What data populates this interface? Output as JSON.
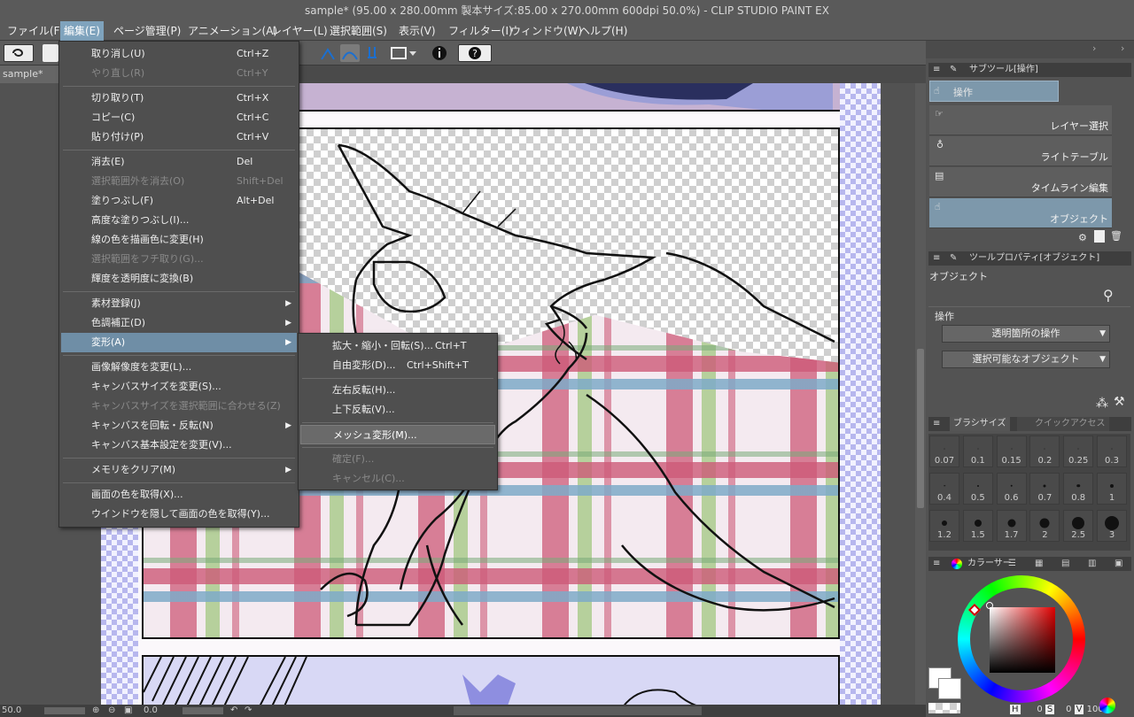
{
  "title": "sample* (95.00 x 280.00mm 製本サイズ:85.00 x 270.00mm 600dpi 50.0%)  - CLIP STUDIO PAINT EX",
  "menubar": [
    "ファイル(F)",
    "編集(E)",
    "ページ管理(P)",
    "アニメーション(A)",
    "レイヤー(L)",
    "選択範囲(S)",
    "表示(V)",
    "フィルター(I)",
    "ウィンドウ(W)",
    "ヘルプ(H)"
  ],
  "doc_tab": "sample*",
  "edit_menu": [
    {
      "label": "取り消し(U)",
      "shortcut": "Ctrl+Z",
      "disabled": false
    },
    {
      "label": "やり直し(R)",
      "shortcut": "Ctrl+Y",
      "disabled": true
    },
    {
      "label": "切り取り(T)",
      "shortcut": "Ctrl+X",
      "disabled": false
    },
    {
      "label": "コピー(C)",
      "shortcut": "Ctrl+C",
      "disabled": false
    },
    {
      "label": "貼り付け(P)",
      "shortcut": "Ctrl+V",
      "disabled": false
    },
    {
      "label": "消去(E)",
      "shortcut": "Del",
      "disabled": false
    },
    {
      "label": "選択範囲外を消去(O)",
      "shortcut": "Shift+Del",
      "disabled": true
    },
    {
      "label": "塗りつぶし(F)",
      "shortcut": "Alt+Del",
      "disabled": false
    },
    {
      "label": "高度な塗りつぶし(I)...",
      "shortcut": "",
      "disabled": false
    },
    {
      "label": "線の色を描画色に変更(H)",
      "shortcut": "",
      "disabled": false
    },
    {
      "label": "選択範囲をフチ取り(G)...",
      "shortcut": "",
      "disabled": true
    },
    {
      "label": "輝度を透明度に変換(B)",
      "shortcut": "",
      "disabled": false
    },
    {
      "label": "素材登録(J)",
      "shortcut": "",
      "disabled": false,
      "submenu": true
    },
    {
      "label": "色調補正(D)",
      "shortcut": "",
      "disabled": false,
      "submenu": true
    },
    {
      "label": "変形(A)",
      "shortcut": "",
      "disabled": false,
      "submenu": true,
      "highlight": true
    },
    {
      "label": "画像解像度を変更(L)...",
      "shortcut": "",
      "disabled": false
    },
    {
      "label": "キャンバスサイズを変更(S)...",
      "shortcut": "",
      "disabled": false
    },
    {
      "label": "キャンバスサイズを選択範囲に合わせる(Z)",
      "shortcut": "",
      "disabled": true
    },
    {
      "label": "キャンバスを回転・反転(N)",
      "shortcut": "",
      "disabled": false,
      "submenu": true
    },
    {
      "label": "キャンバス基本設定を変更(V)...",
      "shortcut": "",
      "disabled": false
    },
    {
      "label": "メモリをクリア(M)",
      "shortcut": "",
      "disabled": false,
      "submenu": true
    },
    {
      "label": "画面の色を取得(X)...",
      "shortcut": "",
      "disabled": false
    },
    {
      "label": "ウインドウを隠して画面の色を取得(Y)...",
      "shortcut": "",
      "disabled": false
    }
  ],
  "transform_submenu": [
    {
      "label": "拡大・縮小・回転(S)...",
      "shortcut": "Ctrl+T",
      "disabled": false
    },
    {
      "label": "自由変形(D)...",
      "shortcut": "Ctrl+Shift+T",
      "disabled": false
    },
    {
      "label": "左右反転(H)...",
      "shortcut": "",
      "disabled": false
    },
    {
      "label": "上下反転(V)...",
      "shortcut": "",
      "disabled": false
    },
    {
      "label": "メッシュ変形(M)...",
      "shortcut": "",
      "disabled": false,
      "hover": true
    },
    {
      "label": "確定(F)...",
      "shortcut": "",
      "disabled": true
    },
    {
      "label": "キャンセル(C)...",
      "shortcut": "",
      "disabled": true
    }
  ],
  "subtool_panel": {
    "title": "サブツール[操作]",
    "group": "操作",
    "items": [
      "レイヤー選択",
      "ライトテーブル",
      "タイムライン編集",
      "オブジェクト"
    ]
  },
  "tool_property": {
    "title": "ツールプロパティ[オブジェクト]",
    "tool_name": "オブジェクト",
    "section": "操作",
    "dropdown1": "透明箇所の操作",
    "dropdown2": "選択可能なオブジェクト"
  },
  "brush_panel": {
    "tabs": [
      "ブラシサイズ",
      "クイックアクセス"
    ],
    "sizes": [
      "0.07",
      "0.1",
      "0.15",
      "0.2",
      "0.25",
      "0.3",
      "0.4",
      "0.5",
      "0.6",
      "0.7",
      "0.8",
      "1",
      "1.2",
      "1.5",
      "1.7",
      "2",
      "2.5",
      "3"
    ]
  },
  "color_panel": {
    "title": "カラーサー",
    "h_label": "H",
    "h_value": "0",
    "s_label": "S",
    "s_value": "0",
    "v_label": "V",
    "v_value": "100",
    "main_color": "#ffffff",
    "sub_color": "#ffffff",
    "selected_hue_color": "#e00000"
  },
  "status": {
    "zoom": "50.0",
    "angle": "0.0"
  }
}
